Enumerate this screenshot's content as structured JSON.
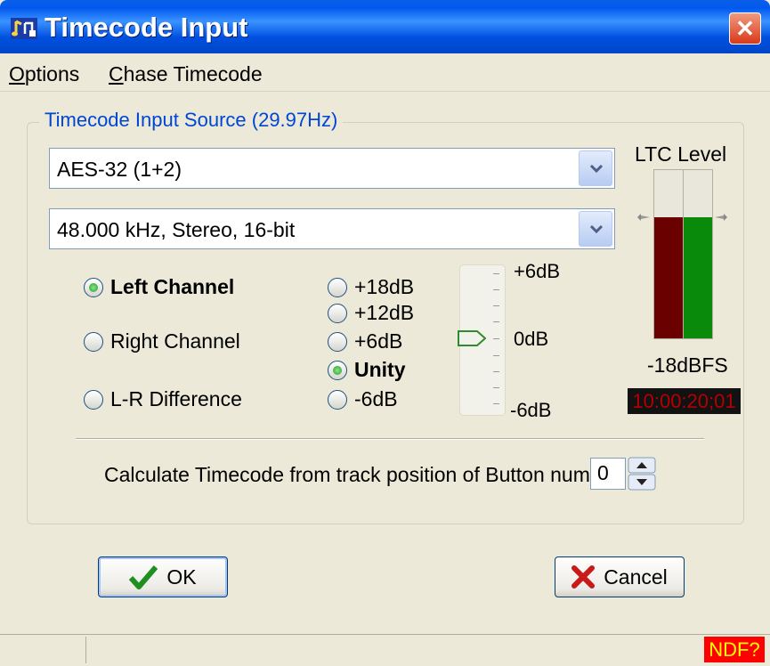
{
  "window": {
    "title": "Timecode Input",
    "close_glyph": "✕"
  },
  "menu": [
    {
      "label": "Options",
      "accel": "O",
      "rest": "ptions"
    },
    {
      "label": "Chase Timecode",
      "accel": "C",
      "rest": "hase Timecode"
    }
  ],
  "group": {
    "label": "Timecode Input Source (29.97Hz)"
  },
  "source": {
    "device": "AES-32 (1+2)",
    "format": "48.000 kHz, Stereo, 16-bit"
  },
  "channels": {
    "selected": "Left Channel",
    "options": [
      "Left Channel",
      "Right Channel",
      "L-R Difference"
    ]
  },
  "gain": {
    "selected": "Unity",
    "options": [
      "+18dB",
      "+12dB",
      "+6dB",
      "Unity",
      "-6dB"
    ]
  },
  "slider": {
    "top_label": "+6dB",
    "mid_label": "0dB",
    "bottom_label": "-6dB",
    "value_db": 0
  },
  "meter": {
    "title": "LTC Level",
    "reference": "-18dBFS",
    "left_level": 0.72,
    "right_level": 0.72,
    "left_color": "#6B0000",
    "right_color": "#0A8A0A",
    "timecode": "10:00:20;01"
  },
  "calc": {
    "label": "Calculate Timecode from track position of Button number",
    "value": "0"
  },
  "buttons": {
    "ok": "OK",
    "cancel": "Cancel"
  },
  "status": {
    "flag": "NDF?"
  },
  "colors": {
    "title_bar": "#0058EE",
    "group_label": "#0046D5",
    "timecode_text": "#B50000",
    "ndf_bg": "#FF0000",
    "ndf_text": "#FFFF00"
  }
}
